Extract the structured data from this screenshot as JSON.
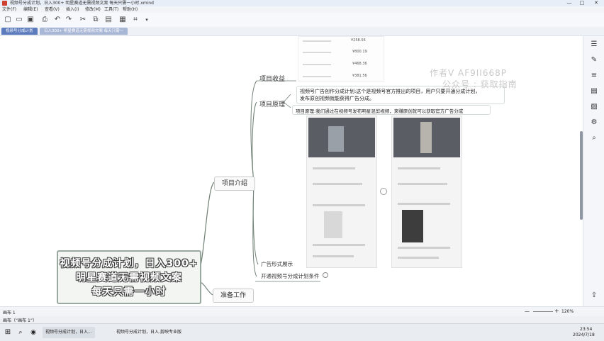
{
  "window": {
    "title": "视频号分成计划，日入300+ 明星赛道无需视频文案 每天只需一小时.xmind",
    "controls": [
      "—",
      "□",
      "✕"
    ]
  },
  "menu": [
    "文件(F)",
    "编辑(E)",
    "查看(V)",
    "插入(I)",
    "修改(M)",
    "工具(T)",
    "帮助(H)"
  ],
  "tabs": [
    {
      "label": "视频号分成计划",
      "active": true
    },
    {
      "label": "日入300+ 明星赛道无需视频文案 每天只需一",
      "active": false
    }
  ],
  "icons": {
    "toolbar": [
      "new-icon",
      "open-icon",
      "save-icon",
      "print-icon",
      "undo-icon",
      "redo-icon",
      "cut-icon",
      "copy-icon",
      "paste-icon",
      "format-icon",
      "expand-icon",
      "chevron-down-icon"
    ],
    "right_panel": [
      "outline-icon",
      "style-icon",
      "list-icon",
      "notes-icon",
      "image-icon",
      "settings-icon",
      "search-icon",
      "share-icon"
    ]
  },
  "mindmap": {
    "central_lines": [
      "视频号分成计划，日入300+",
      "明星赛道无需视频文案",
      "每天只需一小时"
    ],
    "branches": {
      "intro": "项目介绍",
      "prep": "准备工作"
    },
    "sub_topics": {
      "income": "项目收益",
      "principle": "项目原理",
      "ad_form": "广告形式展示",
      "conditions": "开通视频号分成计划条件"
    },
    "principle_text": {
      "line1": "视频号广告创作分成计划:这个是视频号官方推出的项目，用户只要开通分成计划，",
      "line2": "发布原创视频就能获得广告分成。"
    },
    "principle_basis": "项目原理:我们通过在视频号发布明星混剪视频，来赚原创就可以获取官方广告分成",
    "watermark": {
      "line1": "作者V   AF9II668P",
      "line2": "公众号 :  获取指南"
    },
    "income_values": [
      "¥258.56",
      "¥800.19",
      "¥468.36",
      "¥381.56"
    ]
  },
  "status": {
    "left": "画布 1",
    "sheet": "画布（“画布 1”）",
    "zoom": "120%",
    "zoom_minus": "—",
    "zoom_plus": "+"
  },
  "taskbar": {
    "items": [
      "视频号分成计划，日入...",
      "视频号分成计划，日入...",
      "剪映专业版"
    ],
    "time": "23:54",
    "date": "2024/7/18"
  }
}
